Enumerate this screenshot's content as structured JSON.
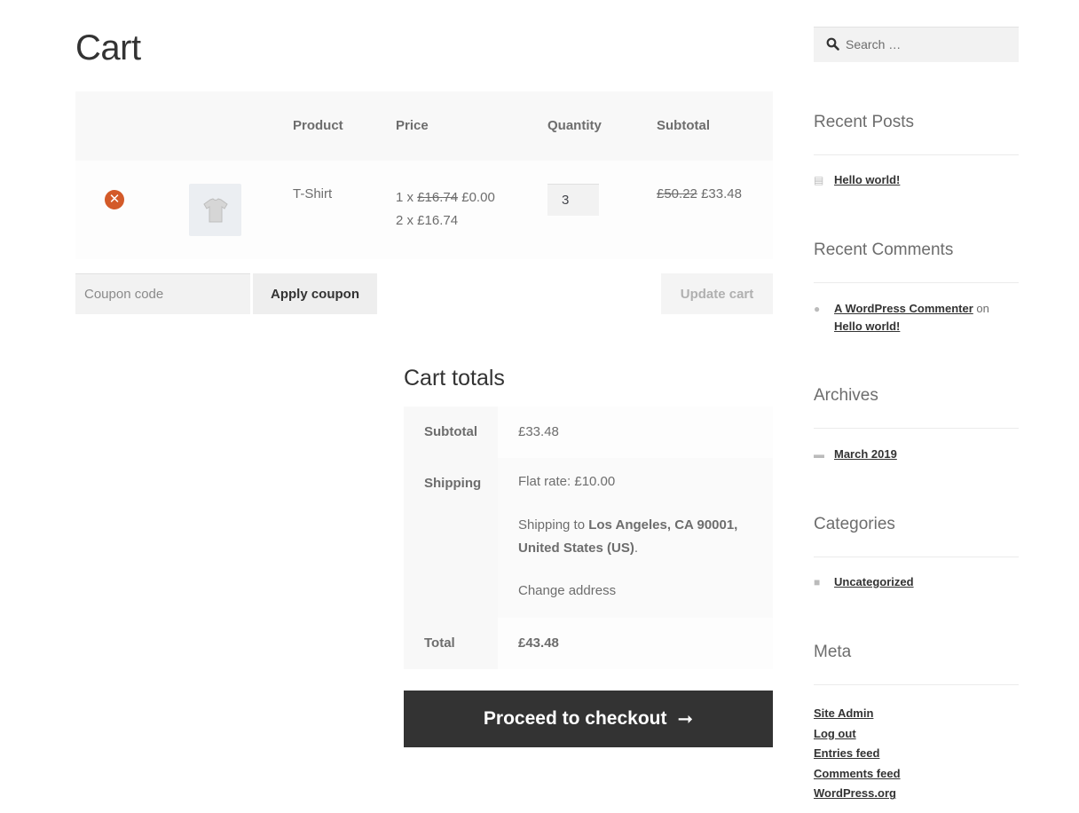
{
  "page": {
    "title": "Cart"
  },
  "cart_table": {
    "headers": [
      "",
      "",
      "Product",
      "Price",
      "Quantity",
      "Subtotal"
    ],
    "rows": [
      {
        "product": "T-Shirt",
        "price_line1_qty": "1 x",
        "price_line1_old": "£16.74",
        "price_line1_new": "£0.00",
        "price_line2": "2 x £16.74",
        "quantity": "3",
        "subtotal_old": "£50.22",
        "subtotal_new": "£33.48"
      }
    ]
  },
  "coupon": {
    "placeholder": "Coupon code",
    "apply_label": "Apply coupon"
  },
  "update_label": "Update cart",
  "totals": {
    "title": "Cart totals",
    "subtotal_label": "Subtotal",
    "subtotal_value": "£33.48",
    "shipping_label": "Shipping",
    "shipping_rate": "Flat rate: £10.00",
    "shipping_to_prefix": "Shipping to",
    "shipping_to_location": "Los Angeles, CA 90001, United States (US)",
    "shipping_to_suffix": ".",
    "change_address": "Change address",
    "total_label": "Total",
    "total_value": "£43.48"
  },
  "checkout": {
    "label": "Proceed to checkout",
    "arrow": "➞"
  },
  "sidebar": {
    "search_placeholder": "Search …",
    "recent_posts": {
      "title": "Recent Posts",
      "items": [
        "Hello world!"
      ]
    },
    "recent_comments": {
      "title": "Recent Comments",
      "author": "A WordPress Commenter",
      "on": "on",
      "post": "Hello world!"
    },
    "archives": {
      "title": "Archives",
      "items": [
        "March 2019"
      ]
    },
    "categories": {
      "title": "Categories",
      "items": [
        "Uncategorized"
      ]
    },
    "meta": {
      "title": "Meta",
      "items": [
        "Site Admin",
        "Log out",
        "Entries feed",
        "Comments feed",
        "WordPress.org"
      ]
    }
  },
  "colors": {
    "remove_icon": "#d35a29",
    "checkout_bg": "#333333"
  }
}
